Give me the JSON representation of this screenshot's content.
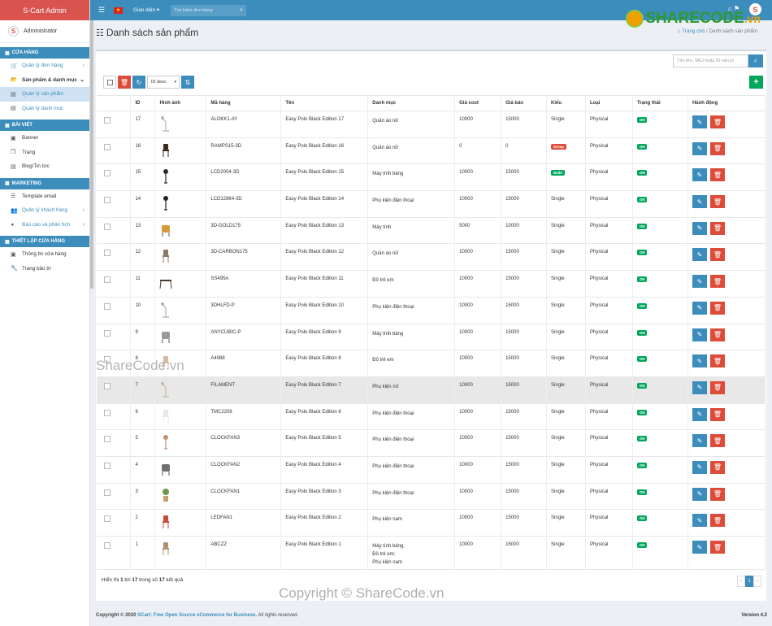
{
  "app": {
    "brand": "S-Cart Admin",
    "user": "Administrator",
    "avatar_letter": "S"
  },
  "sidebar": {
    "sections": [
      {
        "label": "CỬA HÀNG",
        "items": [
          {
            "label": "Quản lý đơn hàng",
            "icon": "cart-icon",
            "chevron": "‹"
          },
          {
            "label": "Sản phẩm & danh mục",
            "icon": "folder-open-icon",
            "chevron": "⌄",
            "bold": true
          },
          {
            "label": "Quản lý sản phẩm",
            "icon": "file-icon",
            "active": true
          },
          {
            "label": "Quản lý danh mục",
            "icon": "file-icon"
          }
        ]
      },
      {
        "label": "BÀI VIẾT",
        "items": [
          {
            "label": "Banner",
            "icon": "image-icon"
          },
          {
            "label": "Trang",
            "icon": "copy-icon"
          },
          {
            "label": "Blog/Tin tức",
            "icon": "file-text-icon"
          }
        ]
      },
      {
        "label": "MARKETING",
        "items": [
          {
            "label": "Template email",
            "icon": "list-icon"
          },
          {
            "label": "Quản lý khách hàng",
            "icon": "users-icon",
            "chevron": "‹"
          },
          {
            "label": "Báo cáo và phân tích",
            "icon": "globe-icon",
            "chevron": "‹"
          }
        ]
      },
      {
        "label": "THIẾT LẬP CỬA HÀNG",
        "items": [
          {
            "label": "Thông tin cửa hàng",
            "icon": "info-icon"
          },
          {
            "label": "Trang bảo trì",
            "icon": "wrench-icon"
          }
        ]
      }
    ]
  },
  "topbar": {
    "theme_label": "Giao diện",
    "search_placeholder": "Tìm kiếm đơn hàng",
    "notif_count": "0"
  },
  "watermark": {
    "brand": "SHARECODE",
    "suffix": ".vn",
    "text": "ShareCode.vn",
    "copyright": "Copyright © ShareCode.vn"
  },
  "page": {
    "title": "Danh sách sản phẩm",
    "breadcrumb_home": "Trang chủ",
    "breadcrumb_current": "Danh sách sản phẩm"
  },
  "toolbar": {
    "search_placeholder": "Tìm tên, SKU hoặc ID sản pl",
    "sort_value": "ID desc"
  },
  "table": {
    "headers": [
      "",
      "ID",
      "Hình ảnh",
      "Mã hàng",
      "Tên",
      "Danh mục",
      "Giá cost",
      "Giá bán",
      "Kiểu",
      "Loại",
      "Trạng thái",
      "Hành động"
    ],
    "rows": [
      {
        "id": "17",
        "sku": "ALOKK1-AY",
        "name": "Easy Polo Black Edition 17",
        "cat": "Quần áo nữ",
        "cost": "10000",
        "price": "15000",
        "kind": "Single",
        "kindBadge": "",
        "type": "Physical",
        "status": "ON",
        "img": "lamp",
        "imgColor": "#b0b8b0"
      },
      {
        "id": "16",
        "sku": "RAMPS15-3D",
        "name": "Easy Polo Black Edition 16",
        "cat": "Quần áo nữ",
        "cost": "0",
        "price": "0",
        "kind": "Group",
        "kindBadge": "red",
        "type": "Physical",
        "status": "ON",
        "img": "chair",
        "imgColor": "#3a2a1e"
      },
      {
        "id": "15",
        "sku": "LCD2004-3D",
        "name": "Easy Polo Black Edition 15",
        "cat": "Máy tính bảng",
        "cost": "10000",
        "price": "15000",
        "kind": "Build",
        "kindBadge": "green",
        "type": "Physical",
        "status": "ON",
        "img": "stool",
        "imgColor": "#2b2b2b"
      },
      {
        "id": "14",
        "sku": "LCD12864-3D",
        "name": "Easy Polo Black Edition 14",
        "cat": "Phụ kiện điện thoại",
        "cost": "10000",
        "price": "15000",
        "kind": "Single",
        "kindBadge": "",
        "type": "Physical",
        "status": "ON",
        "img": "stool",
        "imgColor": "#222"
      },
      {
        "id": "13",
        "sku": "3D-GOLD175",
        "name": "Easy Polo Black Edition 13",
        "cat": "Máy tính",
        "cost": "5000",
        "price": "10000",
        "kind": "Single",
        "kindBadge": "",
        "type": "Physical",
        "status": "ON",
        "img": "armchair",
        "imgColor": "#d79a3a"
      },
      {
        "id": "12",
        "sku": "3D-CARBON175",
        "name": "Easy Polo Black Edition 12",
        "cat": "Quần áo nữ",
        "cost": "10000",
        "price": "15000",
        "kind": "Single",
        "kindBadge": "",
        "type": "Physical",
        "status": "ON",
        "img": "chair",
        "imgColor": "#8a7a6a"
      },
      {
        "id": "11",
        "sku": "SS495A",
        "name": "Easy Polo Black Edition 11",
        "cat": "Đồ trẻ em",
        "cost": "10000",
        "price": "15000",
        "kind": "Single",
        "kindBadge": "",
        "type": "Physical",
        "status": "ON",
        "img": "desk",
        "imgColor": "#4a3a30"
      },
      {
        "id": "10",
        "sku": "3DHLFD-P",
        "name": "Easy Polo Black Edition 10",
        "cat": "Phụ kiện điện thoại",
        "cost": "10000",
        "price": "15000",
        "kind": "Single",
        "kindBadge": "",
        "type": "Physical",
        "status": "ON",
        "img": "lamp",
        "imgColor": "#aab6aa"
      },
      {
        "id": "9",
        "sku": "ANYCUBIC-P",
        "name": "Easy Polo Black Edition 9",
        "cat": "Máy tính bảng",
        "cost": "10000",
        "price": "15000",
        "kind": "Single",
        "kindBadge": "",
        "type": "Physical",
        "status": "ON",
        "img": "armchair",
        "imgColor": "#9a9a96"
      },
      {
        "id": "8",
        "sku": "A4988",
        "name": "Easy Polo Black Edition 8",
        "cat": "Đồ trẻ em",
        "cost": "10000",
        "price": "15000",
        "kind": "Single",
        "kindBadge": "",
        "type": "Physical",
        "status": "ON",
        "img": "chair",
        "imgColor": "#d4b8a0"
      },
      {
        "id": "7",
        "sku": "FILAMENT",
        "name": "Easy Polo Black Edition 7",
        "cat": "Phụ kiện nữ",
        "cost": "10000",
        "price": "15000",
        "kind": "Single",
        "kindBadge": "",
        "type": "Physical",
        "status": "ON",
        "img": "lamp",
        "imgColor": "#c8b8a0"
      },
      {
        "id": "6",
        "sku": "TMC2208",
        "name": "Easy Polo Black Edition 6",
        "cat": "Phụ kiện điện thoại",
        "cost": "10000",
        "price": "15000",
        "kind": "Single",
        "kindBadge": "",
        "type": "Physical",
        "status": "ON",
        "img": "chair",
        "imgColor": "#e8e8e8"
      },
      {
        "id": "5",
        "sku": "CLOCKFAN3",
        "name": "Easy Polo Black Edition 5",
        "cat": "Phụ kiện điện thoại",
        "cost": "10000",
        "price": "15000",
        "kind": "Single",
        "kindBadge": "",
        "type": "Physical",
        "status": "ON",
        "img": "stool",
        "imgColor": "#c09070"
      },
      {
        "id": "4",
        "sku": "CLOCKFAN2",
        "name": "Easy Polo Black Edition 4",
        "cat": "Phụ kiện điện thoại",
        "cost": "10000",
        "price": "15000",
        "kind": "Single",
        "kindBadge": "",
        "type": "Physical",
        "status": "ON",
        "img": "armchair",
        "imgColor": "#707074"
      },
      {
        "id": "3",
        "sku": "CLOCKFAN1",
        "name": "Easy Polo Black Edition 3",
        "cat": "Phụ kiện điện thoại",
        "cost": "10000",
        "price": "15000",
        "kind": "Single",
        "kindBadge": "",
        "type": "Physical",
        "status": "ON",
        "img": "plant",
        "imgColor": "#6a9a4a"
      },
      {
        "id": "2",
        "sku": "LEDFAN1",
        "name": "Easy Polo Black Edition 2",
        "cat": "Phụ kiện nam",
        "cost": "10000",
        "price": "15000",
        "kind": "Single",
        "kindBadge": "",
        "type": "Physical",
        "status": "ON",
        "img": "chair",
        "imgColor": "#c84a3a"
      },
      {
        "id": "1",
        "sku": "ABCZZ",
        "name": "Easy Polo Black Edition 1",
        "cat": "Máy tính bảng;\nĐồ trẻ em;\nPhụ kiện nam",
        "cost": "10000",
        "price": "15000",
        "kind": "Single",
        "kindBadge": "",
        "type": "Physical",
        "status": "ON",
        "img": "chair",
        "imgColor": "#b09070"
      }
    ]
  },
  "pagination": {
    "info_prefix": "Hiển thị",
    "from": "1",
    "to_word": "tới",
    "to": "17",
    "of_word": "trong số",
    "total": "17",
    "suffix": "kết quả",
    "current_page": "1",
    "prev": "‹",
    "next": "›"
  },
  "footer": {
    "copyright": "Copyright © 2020",
    "link": "SCart: Free Open Source eCommerce for Business.",
    "rights": "All rights reserved.",
    "version": "Version 4.2"
  },
  "colors": {
    "primary": "#3c8dbc",
    "danger": "#dd4b39",
    "success": "#00a65a",
    "brand": "#d9534f"
  }
}
